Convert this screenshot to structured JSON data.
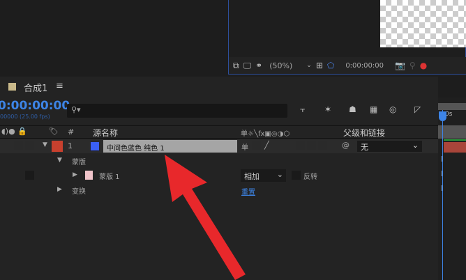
{
  "viewer": {
    "zoom": "(50%)",
    "timecode": "0:00:00:00"
  },
  "comp_tab": {
    "label": "合成1",
    "menu": "≡"
  },
  "timecode": {
    "value": "0:00:00:00",
    "frames": "00000 (25.00 fps)"
  },
  "search": {
    "placeholder": ""
  },
  "columns": {
    "hash": "#",
    "source_name": "源名称",
    "switches": "单☼╲fx▣◎◑⬡",
    "parent": "父级和链接"
  },
  "layer": {
    "number": "1",
    "name": "中间色蓝色 纯色 1",
    "parent": "无",
    "label_color": "#c8402e",
    "solid_color": "#3a5ff5"
  },
  "mask_group": {
    "label": "蒙版"
  },
  "mask": {
    "label": "蒙版 1",
    "mode": "相加",
    "invert": "反转",
    "color": "#f0c4ca"
  },
  "transform": {
    "label": "变换",
    "reset": "重置"
  },
  "timeline": {
    "ruler": "0s"
  }
}
